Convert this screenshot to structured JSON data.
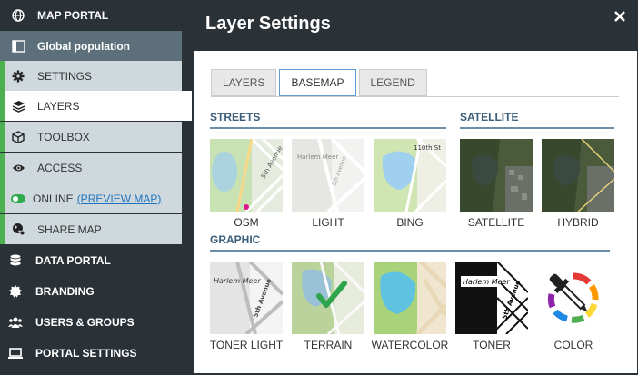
{
  "sidebar": {
    "map_portal": "MAP PORTAL",
    "global_population": "Global population",
    "settings": "SETTINGS",
    "layers": "LAYERS",
    "toolbox": "TOOLBOX",
    "access": "ACCESS",
    "online": "ONLINE",
    "preview_map": "(PREVIEW MAP)",
    "share_map": "SHARE MAP",
    "data_portal": "DATA PORTAL",
    "branding": "BRANDING",
    "users_groups": "USERS & GROUPS",
    "portal_settings": "PORTAL SETTINGS"
  },
  "panel": {
    "title": "Layer Settings",
    "close_symbol": "✖"
  },
  "tabs": [
    "LAYERS",
    "BASEMAP",
    "LEGEND"
  ],
  "active_tab": "BASEMAP",
  "sections": {
    "streets": "STREETS",
    "satellite": "SATELLITE",
    "graphic": "GRAPHIC"
  },
  "basemaps": {
    "osm": "OSM",
    "light": "LIGHT",
    "bing": "BING",
    "satellite": "SATELLITE",
    "hybrid": "HYBRID",
    "toner_light": "TONER LIGHT",
    "terrain": "TERRAIN",
    "watercolor": "WATERCOLOR",
    "toner": "TONER",
    "color": "COLOR"
  },
  "map_text": {
    "osm_street": "5th Avenue",
    "light_place": "Harlem Meer",
    "light_street": "5th Avenue",
    "bing_street": "110th St",
    "toner_light_place": "Harlem Meer",
    "toner_light_street": "5th Avenue",
    "toner_place": "Harlem Meer",
    "toner_street": "5th Avenue"
  },
  "selected_basemap": "terrain",
  "colors": {
    "sidebar_bg": "#2a3137",
    "highlight_bg": "#5c6f7a",
    "sub_bg": "#cfd8dc",
    "accent_green": "#4caf50",
    "link_blue": "#1e73be",
    "section_blue": "#3a5d79"
  }
}
